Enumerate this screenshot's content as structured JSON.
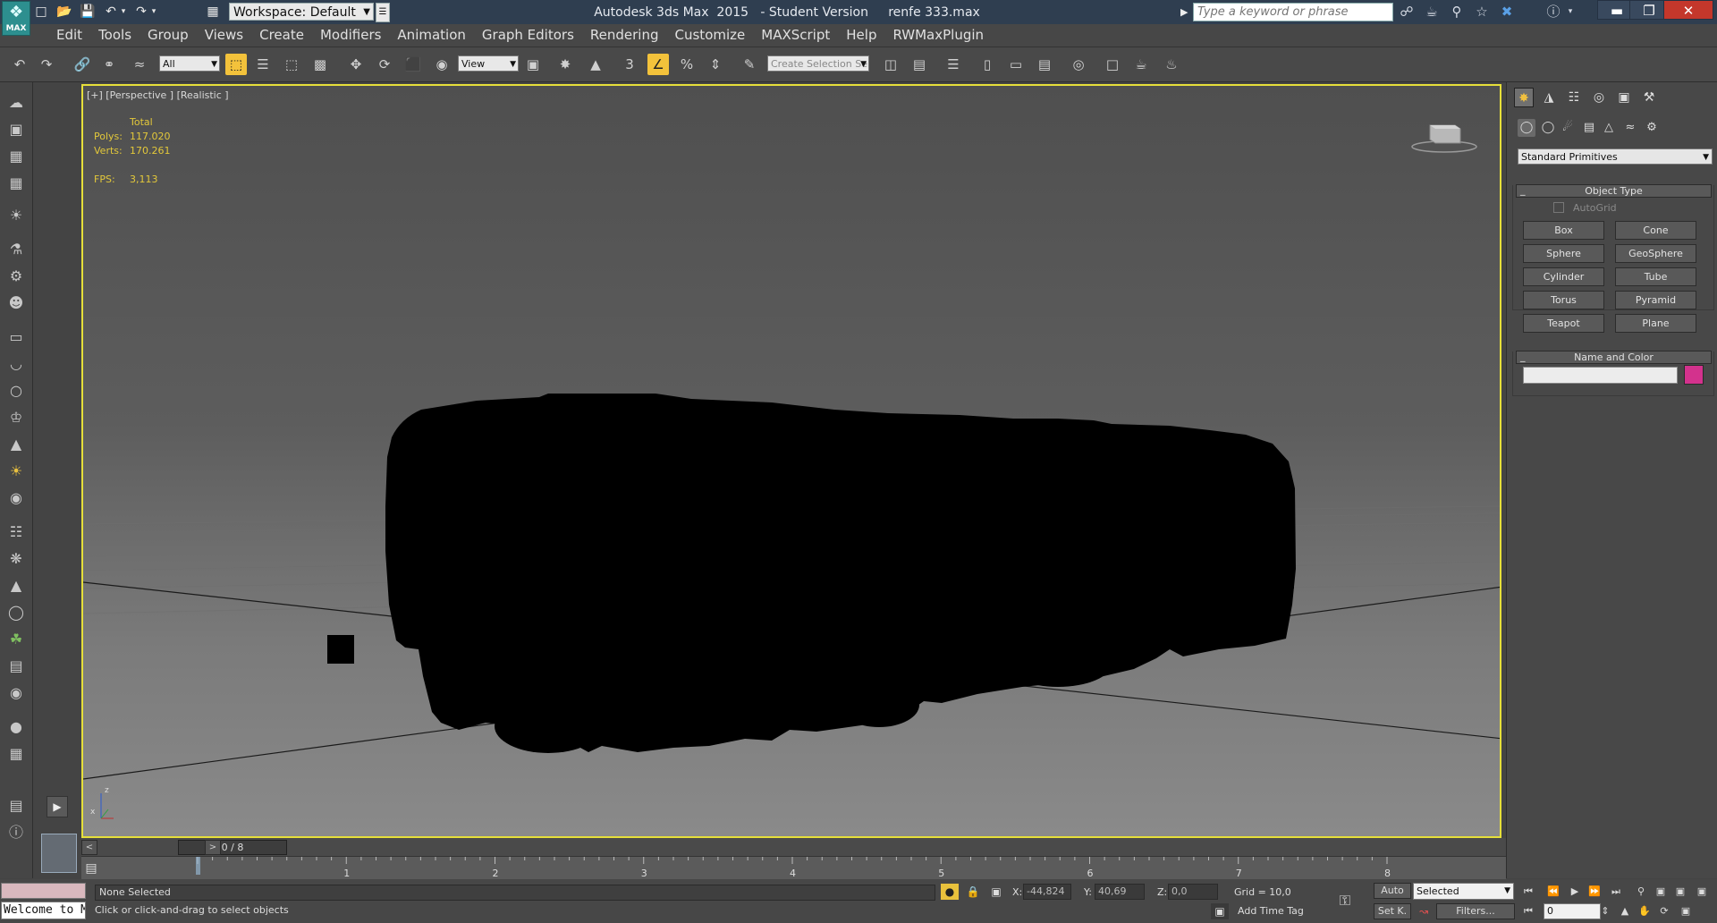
{
  "app": {
    "logo_text": "MAX",
    "window_title": "Autodesk 3ds Max  2015   - Student Version     renfe 333.max",
    "workspace": "Workspace: Default",
    "search_placeholder": "Type a keyword or phrase"
  },
  "menu": [
    "Edit",
    "Tools",
    "Group",
    "Views",
    "Create",
    "Modifiers",
    "Animation",
    "Graph Editors",
    "Rendering",
    "Customize",
    "MAXScript",
    "Help",
    "RWMaxPlugin"
  ],
  "toolbar": {
    "filter_value": "All",
    "reference_coord": "View",
    "snap_value": "3",
    "named_selection_placeholder": "Create Selection Se"
  },
  "viewport": {
    "label": "[+] [Perspective ] [Realistic ]",
    "stats": {
      "header": "Total",
      "polys_label": "Polys:",
      "polys_value": "117.020",
      "verts_label": "Verts:",
      "verts_value": "170.261",
      "fps_label": "FPS:",
      "fps_value": "3,113"
    },
    "axis_z": "z",
    "axis_x": "x"
  },
  "command_panel": {
    "primitive_type": "Standard Primitives",
    "object_type_title": "Object Type",
    "autogrid_label": "AutoGrid",
    "object_buttons": [
      "Box",
      "Cone",
      "Sphere",
      "GeoSphere",
      "Cylinder",
      "Tube",
      "Torus",
      "Pyramid",
      "Teapot",
      "Plane"
    ],
    "name_color_title": "Name and Color",
    "object_color": "#d3328d"
  },
  "timeline": {
    "frame_display": "0 / 8",
    "ticks": [
      "1",
      "2",
      "3",
      "4",
      "5",
      "6",
      "7",
      "8"
    ],
    "tick_positions": [
      1,
      2,
      3,
      4,
      5,
      6,
      7,
      8
    ],
    "total_frames": 8
  },
  "status": {
    "listener_text": "Welcome to MAXScript.",
    "selection": "None Selected",
    "prompt": "Click or click-and-drag to select objects",
    "x_label": "X:",
    "x_value": "-44,824",
    "y_label": "Y:",
    "y_value": "40,69",
    "z_label": "Z:",
    "z_value": "0,0",
    "grid": "Grid = 10,0",
    "add_time_tag": "Add Time Tag",
    "auto_key": "Auto",
    "set_key": "Set K.",
    "key_filter_select": "Selected",
    "filters": "Filters...",
    "current_frame": "0"
  }
}
